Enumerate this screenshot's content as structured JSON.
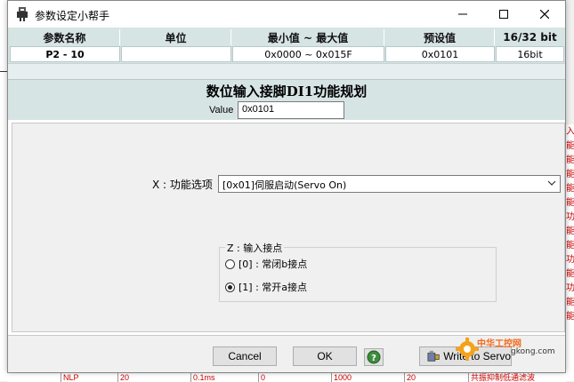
{
  "window": {
    "title": "参数设定小帮手"
  },
  "param_table": {
    "headers": [
      "参数名称",
      "单位",
      "最小值 ~ 最大值",
      "预设值",
      "16/32 bit"
    ],
    "values": [
      "P2 - 10",
      "",
      "0x0000 ~ 0x015F",
      "0x0101",
      "16bit"
    ]
  },
  "section": {
    "title": "数位输入接脚DI1功能规划",
    "value_label": "Value",
    "value": "0x0101"
  },
  "function_select": {
    "label": "X : 功能选项",
    "selected": "[0x01]伺服启动(Servo On)"
  },
  "input_contact": {
    "legend": "Z : 输入接点",
    "options": [
      {
        "label": "[0] : 常闭b接点",
        "checked": false
      },
      {
        "label": "[1] : 常开a接点",
        "checked": true
      }
    ]
  },
  "buttons": {
    "cancel": "Cancel",
    "ok": "OK",
    "write": "Write to Servo"
  },
  "watermark": {
    "brand": "中华工控网",
    "url": "gkong.com"
  },
  "background": {
    "right_chars": [
      "入",
      "能",
      "能",
      "能",
      "能",
      "能",
      "功",
      "能",
      "能",
      "功",
      "能",
      "功",
      "能",
      "能"
    ],
    "bottom_cells": [
      "NLP",
      "20",
      "0.1ms",
      "0",
      "1000",
      "20",
      "共振抑制低通滤波"
    ]
  },
  "colors": {
    "header_bg": "#d7e4e4",
    "background_text": "#cc0000",
    "watermark_orange": "#f26a1b"
  }
}
